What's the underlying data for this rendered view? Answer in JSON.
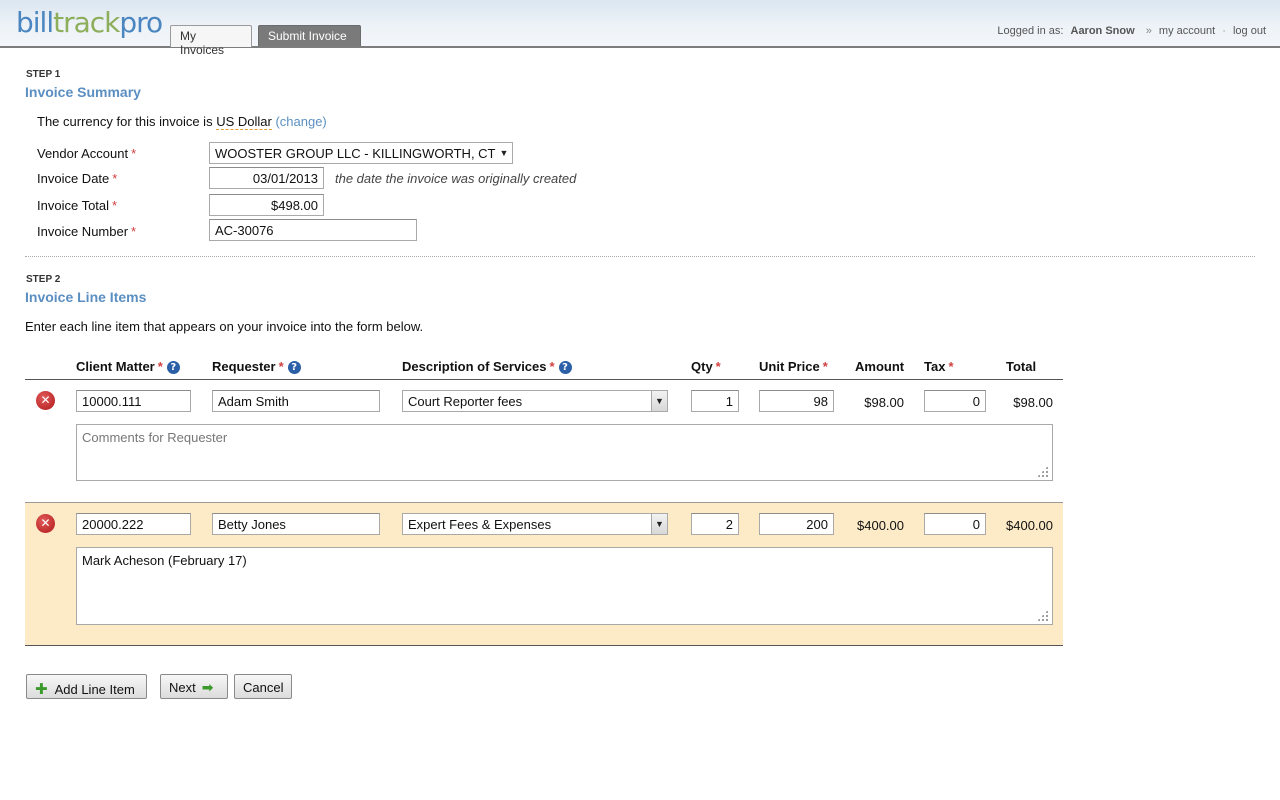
{
  "header": {
    "logo": {
      "part1": "bill",
      "part2": "track",
      "part3": "pro"
    },
    "tabs": [
      {
        "label": "My Invoices"
      },
      {
        "label": "Submit Invoice"
      }
    ],
    "user": {
      "logged_in_label": "Logged in as:",
      "name": "Aaron Snow",
      "separator": "»",
      "account_link": "my account",
      "dot": "·",
      "logout_link": "log out"
    }
  },
  "step1": {
    "label": "STEP 1",
    "title": "Invoice Summary",
    "currency_text": "The currency for this invoice is",
    "currency_value": "US Dollar",
    "currency_change": "(change)",
    "fields": {
      "vendor": {
        "label": "Vendor Account",
        "value": "WOOSTER GROUP LLC - KILLINGWORTH, CT"
      },
      "date": {
        "label": "Invoice Date",
        "value": "03/01/2013",
        "hint": "the date the invoice was originally created"
      },
      "total": {
        "label": "Invoice Total",
        "value": "$498.00"
      },
      "number": {
        "label": "Invoice Number",
        "value": "AC-30076"
      }
    },
    "required_marker": "*"
  },
  "step2": {
    "label": "STEP 2",
    "title": "Invoice Line Items",
    "instructions": "Enter each line item that appears on your invoice into the form below.",
    "columns": {
      "client_matter": "Client Matter",
      "requester": "Requester",
      "description": "Description of Services",
      "qty": "Qty",
      "unit_price": "Unit Price",
      "amount": "Amount",
      "tax": "Tax",
      "total": "Total"
    },
    "help_glyph": "?",
    "remove_glyph": "✕",
    "rows": [
      {
        "client_matter": "10000.111",
        "requester": "Adam Smith",
        "description": "Court Reporter fees",
        "qty": "1",
        "unit_price": "98",
        "amount": "$98.00",
        "tax": "0",
        "total": "$98.00",
        "comment": "",
        "comment_placeholder": "Comments for Requester"
      },
      {
        "client_matter": "20000.222",
        "requester": "Betty Jones",
        "description": "Expert Fees & Expenses",
        "qty": "2",
        "unit_price": "200",
        "amount": "$400.00",
        "tax": "0",
        "total": "$400.00",
        "comment": "Mark Acheson (February 17)",
        "comment_placeholder": ""
      }
    ]
  },
  "actions": {
    "add_line_item": "Add Line Item",
    "next": "Next",
    "cancel": "Cancel"
  },
  "colors": {
    "accent": "#5b8fc2",
    "required": "#d04040",
    "highlight_row": "#fdebc8",
    "remove": "#b01818",
    "add": "#3c9a2c"
  }
}
